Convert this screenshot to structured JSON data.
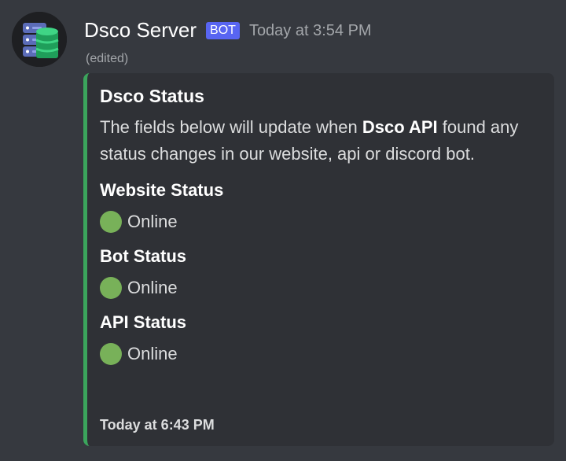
{
  "message": {
    "author": {
      "name": "Dsco Server",
      "avatar_icon": "database-server-icon"
    },
    "bot_tag": "BOT",
    "timestamp": "Today at 3:54 PM",
    "edited_label": "(edited)"
  },
  "embed": {
    "accent_color": "#3ba55c",
    "title": "Dsco Status",
    "description_before": "The fields below will update when ",
    "description_bold": "Dsco API",
    "description_after": " found any status changes in our website, api or discord bot.",
    "fields": [
      {
        "name": "Website Status",
        "status_icon": "green-circle-icon",
        "value": "Online"
      },
      {
        "name": "Bot Status",
        "status_icon": "green-circle-icon",
        "value": "Online"
      },
      {
        "name": "API Status",
        "status_icon": "green-circle-icon",
        "value": "Online"
      }
    ],
    "footer_timestamp": "Today at 6:43 PM"
  },
  "colors": {
    "background": "#36393f",
    "embed_background": "#2f3136",
    "bot_tag": "#5865f2",
    "status_online": "#78b159"
  }
}
